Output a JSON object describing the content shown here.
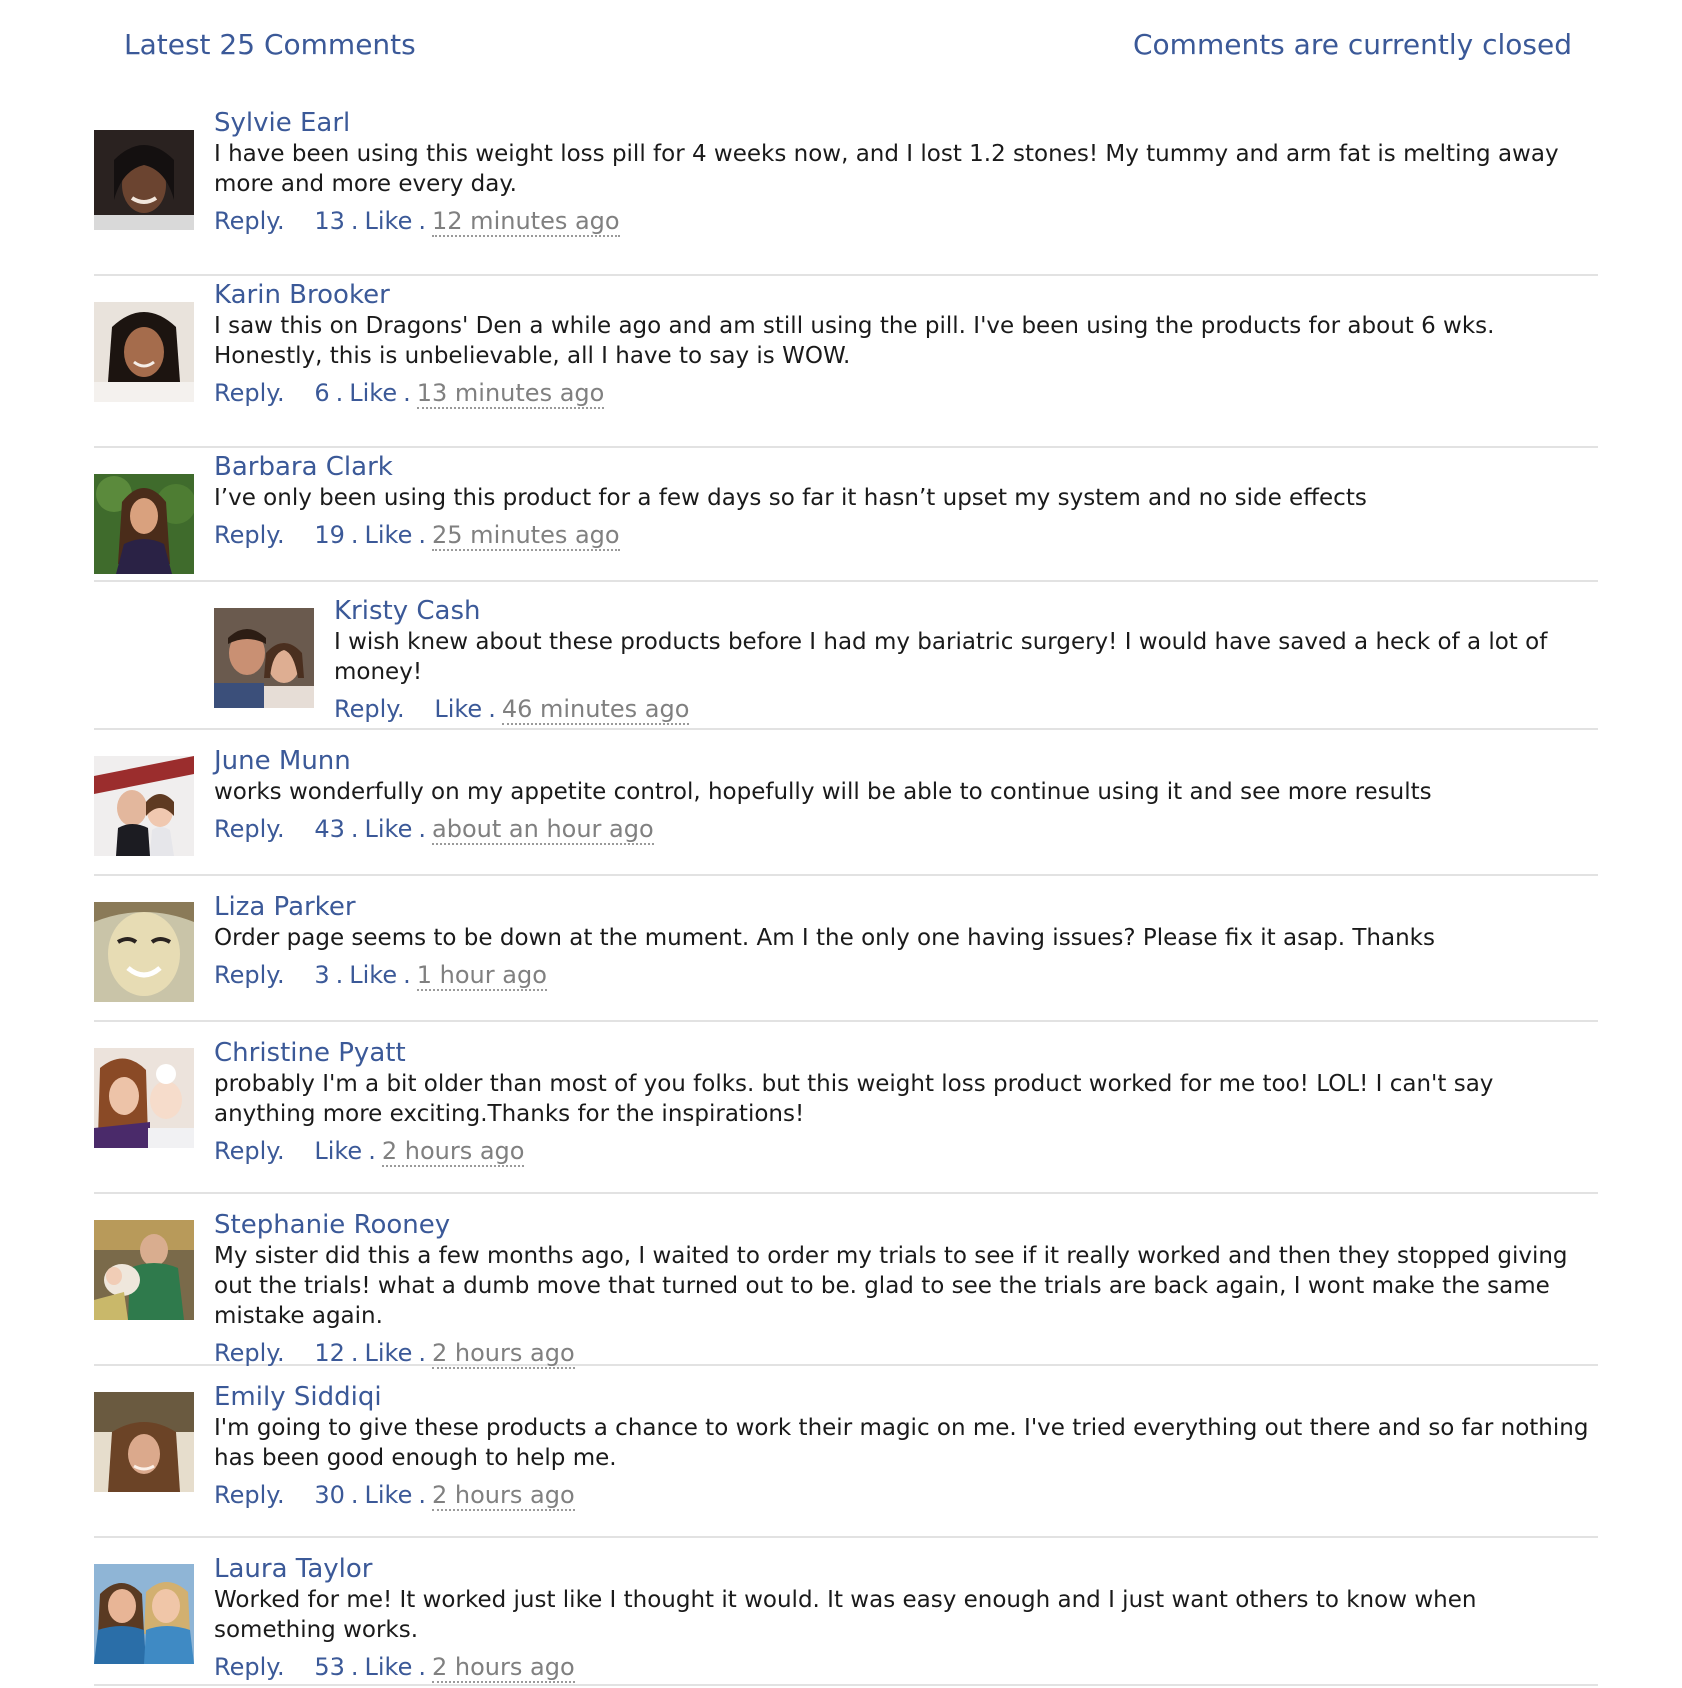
{
  "header": {
    "title": "Latest 25 Comments",
    "status": "Comments are currently closed"
  },
  "comments": [
    {
      "author": "Sylvie Earl",
      "text": "I have been using this weight loss pill for 4 weeks now, and I lost 1.2 stones! My tummy and arm fat is melting away more and more every day.",
      "reply_label": "Reply.",
      "likes": "13",
      "like_label": "Like",
      "time": "12 minutes ago"
    },
    {
      "author": "Karin Brooker",
      "text": "I saw this on Dragons' Den a while ago and am still using the pill. I've been using the products for about 6 wks. Honestly, this is unbelievable, all I have to say is WOW.",
      "reply_label": "Reply.",
      "likes": "6",
      "like_label": "Like",
      "time": "13 minutes ago"
    },
    {
      "author": "Barbara Clark",
      "text": "I’ve only been using this product for a few days so far it hasn’t upset my system and no side effects",
      "reply_label": "Reply.",
      "likes": "19",
      "like_label": "Like",
      "time": "25 minutes ago"
    },
    {
      "author": "Kristy Cash",
      "text": "I wish knew about these products before I had my bariatric surgery! I would have saved a heck of a lot of money!",
      "reply_label": "Reply.",
      "likes": "",
      "like_label": "Like",
      "time": "46 minutes ago"
    },
    {
      "author": "June Munn",
      "text": "works wonderfully on my appetite control, hopefully will be able to continue using it and see more results",
      "reply_label": "Reply.",
      "likes": "43",
      "like_label": "Like",
      "time": "about an hour ago"
    },
    {
      "author": "Liza Parker",
      "text": "Order page seems to be down at the mument. Am I the only one having issues? Please fix it asap. Thanks",
      "reply_label": "Reply.",
      "likes": "3",
      "like_label": "Like",
      "time": "1 hour ago"
    },
    {
      "author": "Christine Pyatt",
      "text": "probably I'm a bit older than most of you folks. but this weight loss product worked for me too! LOL! I can't say anything more exciting.Thanks for the inspirations!",
      "reply_label": "Reply.",
      "likes": "",
      "like_label": "Like",
      "time": "2 hours ago"
    },
    {
      "author": "Stephanie Rooney",
      "text": "My sister did this a few months ago, I waited to order my trials to see if it really worked and then they stopped giving out the trials! what a dumb move that turned out to be. glad to see the trials are back again, I wont make the same mistake again.",
      "reply_label": "Reply.",
      "likes": "12",
      "like_label": "Like",
      "time": "2 hours ago"
    },
    {
      "author": "Emily Siddiqi",
      "text": "I'm going to give these products a chance to work their magic on me. I've tried everything out there and so far nothing has been good enough to help me.",
      "reply_label": "Reply.",
      "likes": "30",
      "like_label": "Like",
      "time": "2 hours ago"
    },
    {
      "author": "Laura Taylor",
      "text": "Worked for me! It worked just like I thought it would. It was easy enough and I just want others to know when something works.",
      "reply_label": "Reply.",
      "likes": "53",
      "like_label": "Like",
      "time": "2 hours ago"
    }
  ],
  "colors": {
    "link": "#3b5998",
    "time": "#808080",
    "divider": "#e2e2e2"
  }
}
